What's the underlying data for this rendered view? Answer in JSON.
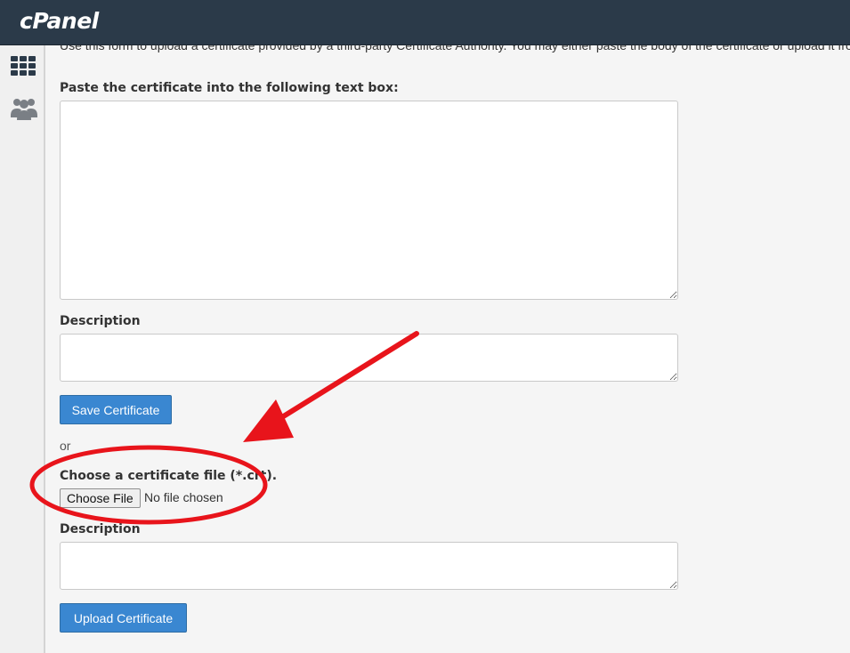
{
  "header": {
    "logo_text": "cPanel"
  },
  "sidebar": {
    "items": [
      {
        "icon": "grid-icon"
      },
      {
        "icon": "users-icon"
      }
    ]
  },
  "form": {
    "intro": "Use this form to upload a certificate provided by a third-party Certificate Authority. You may either paste the body of the certificate or upload it from a .crt file.",
    "paste_label": "Paste the certificate into the following text box:",
    "paste_value": "",
    "description1_label": "Description",
    "description1_value": "",
    "save_button": "Save Certificate",
    "or_text": "or",
    "file_label": "Choose a certificate file (*.crt).",
    "choose_file_button": "Choose File",
    "file_status": "No file chosen",
    "description2_label": "Description",
    "description2_value": "",
    "upload_button": "Upload Certificate"
  },
  "colors": {
    "header_bg": "#2b3a49",
    "primary_button": "#3a87d1",
    "annotation_red": "#e8141b"
  }
}
